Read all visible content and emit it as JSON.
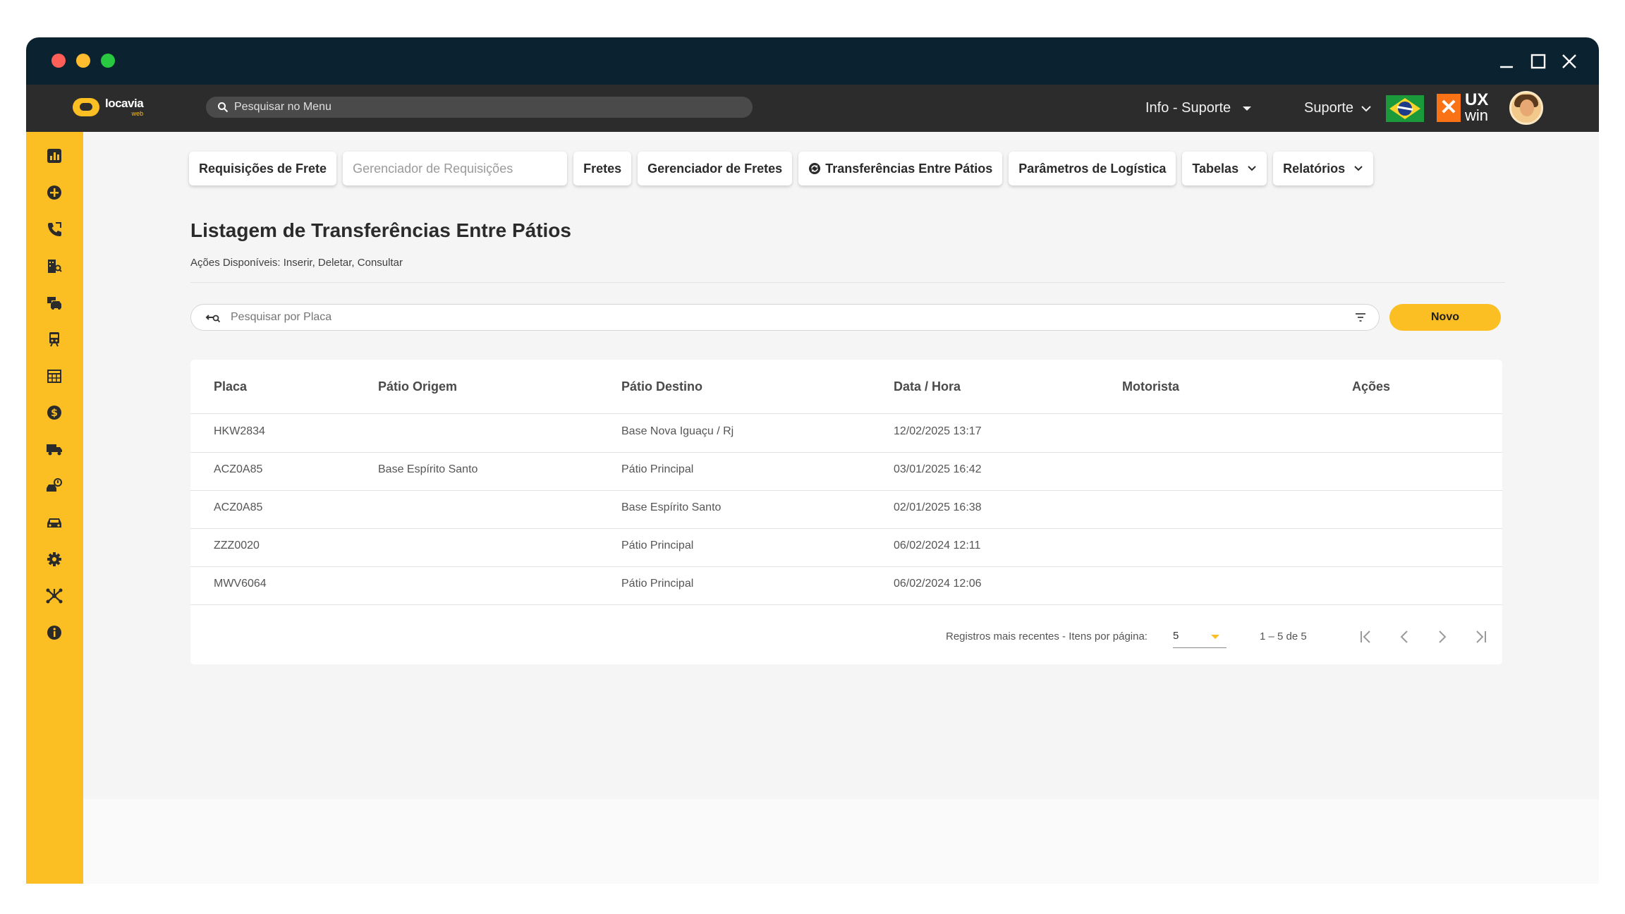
{
  "app": {
    "logo_text": "locavia",
    "logo_sub": "web",
    "menu_search_placeholder": "Pesquisar no Menu",
    "info_menu": "Info - Suporte",
    "support_menu": "Suporte",
    "partner_logo_top": "UX",
    "partner_logo_bottom": "win"
  },
  "tabs": [
    {
      "label": "Requisições de Frete"
    },
    {
      "label": "Gerenciador de Requisições",
      "type": "input"
    },
    {
      "label": "Fretes"
    },
    {
      "label": "Gerenciador de Fretes"
    },
    {
      "label": "Transferências Entre Pátios",
      "icon": "circle-arrows-icon"
    },
    {
      "label": "Parâmetros de Logística"
    },
    {
      "label": "Tabelas",
      "dropdown": true
    },
    {
      "label": "Relatórios",
      "dropdown": true
    }
  ],
  "page": {
    "title": "Listagem de Transferências Entre Pátios",
    "actions_text": "Ações Disponíveis: Inserir, Deletar, Consultar",
    "search_placeholder": "Pesquisar por Placa",
    "new_button": "Novo"
  },
  "table": {
    "columns": [
      "Placa",
      "Pátio Origem",
      "Pátio Destino",
      "Data / Hora",
      "Motorista",
      "Ações"
    ],
    "rows": [
      {
        "placa": "HKW2834",
        "origem": "",
        "destino": "Base Nova Iguaçu / Rj",
        "data": "12/02/2025 13:17",
        "motorista": ""
      },
      {
        "placa": "ACZ0A85",
        "origem": "Base Espírito Santo",
        "destino": "Pátio Principal",
        "data": "03/01/2025 16:42",
        "motorista": ""
      },
      {
        "placa": "ACZ0A85",
        "origem": "",
        "destino": "Base Espírito Santo",
        "data": "02/01/2025 16:38",
        "motorista": ""
      },
      {
        "placa": "ZZZ0020",
        "origem": "",
        "destino": "Pátio Principal",
        "data": "06/02/2024 12:11",
        "motorista": ""
      },
      {
        "placa": "MWV6064",
        "origem": "",
        "destino": "Pátio Principal",
        "data": "06/02/2024 12:06",
        "motorista": ""
      }
    ]
  },
  "paginator": {
    "label": "Registros mais recentes - Itens por página:",
    "page_size": "5",
    "range": "1 – 5 de 5"
  },
  "sidebar_icons": [
    "dashboard-icon",
    "add-circle-icon",
    "phone-icon",
    "building-search-icon",
    "car-wash-icon",
    "train-icon",
    "calendar-grid-icon",
    "dollar-icon",
    "truck-icon",
    "car-alert-icon",
    "car-icon",
    "gear-icon",
    "network-icon",
    "info-icon"
  ],
  "colors": {
    "accent": "#fbbf24",
    "titlebar": "#0b2230",
    "appbar": "#2c2c2c"
  }
}
